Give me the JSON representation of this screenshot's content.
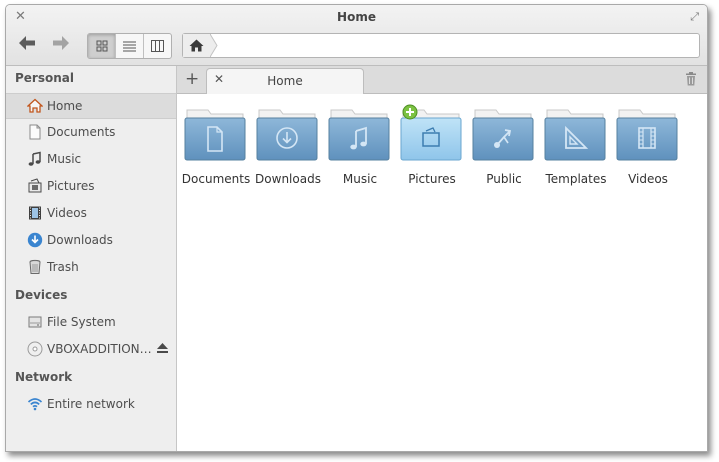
{
  "window": {
    "title": "Home"
  },
  "sidebar": {
    "sections": [
      {
        "title": "Personal",
        "items": [
          {
            "label": "Home",
            "icon": "home-icon"
          },
          {
            "label": "Documents",
            "icon": "document-icon"
          },
          {
            "label": "Music",
            "icon": "music-note-icon"
          },
          {
            "label": "Pictures",
            "icon": "picture-icon"
          },
          {
            "label": "Videos",
            "icon": "film-icon"
          },
          {
            "label": "Downloads",
            "icon": "download-icon"
          },
          {
            "label": "Trash",
            "icon": "trash-icon"
          }
        ]
      },
      {
        "title": "Devices",
        "items": [
          {
            "label": "File System",
            "icon": "drive-icon"
          },
          {
            "label": "VBOXADDITION…",
            "icon": "disc-icon"
          }
        ]
      },
      {
        "title": "Network",
        "items": [
          {
            "label": "Entire network",
            "icon": "wifi-icon"
          }
        ]
      }
    ]
  },
  "tabs": [
    {
      "label": "Home"
    }
  ],
  "files": [
    {
      "name": "Documents",
      "icon": "document-icon"
    },
    {
      "name": "Downloads",
      "icon": "download-icon"
    },
    {
      "name": "Music",
      "icon": "music-note-icon"
    },
    {
      "name": "Pictures",
      "icon": "picture-icon"
    },
    {
      "name": "Public",
      "icon": "share-icon"
    },
    {
      "name": "Templates",
      "icon": "set-square-icon"
    },
    {
      "name": "Videos",
      "icon": "film-icon"
    }
  ],
  "colors": {
    "folder_top": "#8eb7d9",
    "folder_bottom": "#5f91bd",
    "folder_highlight": "#bfe3f7",
    "accent": "#3a85d0"
  }
}
